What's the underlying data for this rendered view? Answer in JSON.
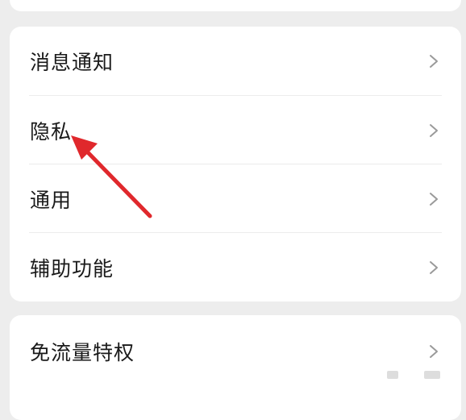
{
  "settings": {
    "items": [
      {
        "label": "消息通知"
      },
      {
        "label": "隐私"
      },
      {
        "label": "通用"
      },
      {
        "label": "辅助功能"
      }
    ],
    "bottom_items": [
      {
        "label": "免流量特权"
      }
    ]
  },
  "annotation": {
    "arrow_color": "#e0282c"
  },
  "icons": {
    "chevron": "chevron-right-icon"
  }
}
